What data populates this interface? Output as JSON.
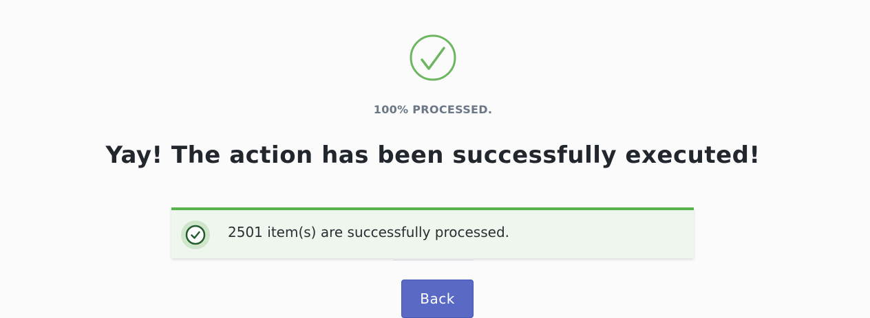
{
  "status": {
    "icon": "check-circle-icon",
    "progress_label": "100% PROCESSED.",
    "headline": "Yay! The action has been successfully executed!"
  },
  "notice": {
    "icon": "check-circle-icon",
    "message": "2501 item(s) are successfully processed.",
    "accent_color": "#57b44c",
    "background_color": "#eff6ed"
  },
  "actions": {
    "back_label": "Back",
    "button_color": "#5a6ac4"
  }
}
